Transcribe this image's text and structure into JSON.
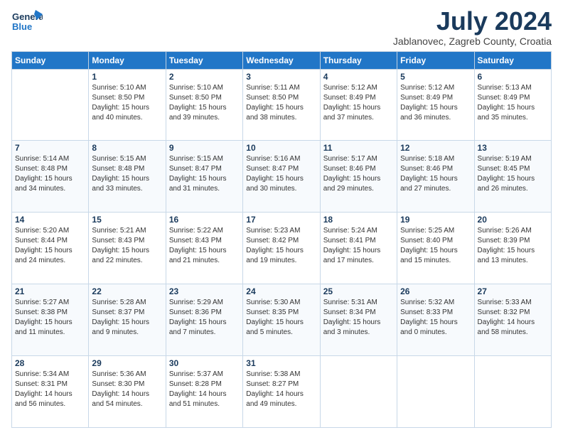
{
  "header": {
    "logo_general": "General",
    "logo_blue": "Blue",
    "main_title": "July 2024",
    "subtitle": "Jablanovec, Zagreb County, Croatia"
  },
  "days": [
    "Sunday",
    "Monday",
    "Tuesday",
    "Wednesday",
    "Thursday",
    "Friday",
    "Saturday"
  ],
  "weeks": [
    [
      {
        "day": "",
        "info": ""
      },
      {
        "day": "1",
        "info": "Sunrise: 5:10 AM\nSunset: 8:50 PM\nDaylight: 15 hours\nand 40 minutes."
      },
      {
        "day": "2",
        "info": "Sunrise: 5:10 AM\nSunset: 8:50 PM\nDaylight: 15 hours\nand 39 minutes."
      },
      {
        "day": "3",
        "info": "Sunrise: 5:11 AM\nSunset: 8:50 PM\nDaylight: 15 hours\nand 38 minutes."
      },
      {
        "day": "4",
        "info": "Sunrise: 5:12 AM\nSunset: 8:49 PM\nDaylight: 15 hours\nand 37 minutes."
      },
      {
        "day": "5",
        "info": "Sunrise: 5:12 AM\nSunset: 8:49 PM\nDaylight: 15 hours\nand 36 minutes."
      },
      {
        "day": "6",
        "info": "Sunrise: 5:13 AM\nSunset: 8:49 PM\nDaylight: 15 hours\nand 35 minutes."
      }
    ],
    [
      {
        "day": "7",
        "info": "Sunrise: 5:14 AM\nSunset: 8:48 PM\nDaylight: 15 hours\nand 34 minutes."
      },
      {
        "day": "8",
        "info": "Sunrise: 5:15 AM\nSunset: 8:48 PM\nDaylight: 15 hours\nand 33 minutes."
      },
      {
        "day": "9",
        "info": "Sunrise: 5:15 AM\nSunset: 8:47 PM\nDaylight: 15 hours\nand 31 minutes."
      },
      {
        "day": "10",
        "info": "Sunrise: 5:16 AM\nSunset: 8:47 PM\nDaylight: 15 hours\nand 30 minutes."
      },
      {
        "day": "11",
        "info": "Sunrise: 5:17 AM\nSunset: 8:46 PM\nDaylight: 15 hours\nand 29 minutes."
      },
      {
        "day": "12",
        "info": "Sunrise: 5:18 AM\nSunset: 8:46 PM\nDaylight: 15 hours\nand 27 minutes."
      },
      {
        "day": "13",
        "info": "Sunrise: 5:19 AM\nSunset: 8:45 PM\nDaylight: 15 hours\nand 26 minutes."
      }
    ],
    [
      {
        "day": "14",
        "info": "Sunrise: 5:20 AM\nSunset: 8:44 PM\nDaylight: 15 hours\nand 24 minutes."
      },
      {
        "day": "15",
        "info": "Sunrise: 5:21 AM\nSunset: 8:43 PM\nDaylight: 15 hours\nand 22 minutes."
      },
      {
        "day": "16",
        "info": "Sunrise: 5:22 AM\nSunset: 8:43 PM\nDaylight: 15 hours\nand 21 minutes."
      },
      {
        "day": "17",
        "info": "Sunrise: 5:23 AM\nSunset: 8:42 PM\nDaylight: 15 hours\nand 19 minutes."
      },
      {
        "day": "18",
        "info": "Sunrise: 5:24 AM\nSunset: 8:41 PM\nDaylight: 15 hours\nand 17 minutes."
      },
      {
        "day": "19",
        "info": "Sunrise: 5:25 AM\nSunset: 8:40 PM\nDaylight: 15 hours\nand 15 minutes."
      },
      {
        "day": "20",
        "info": "Sunrise: 5:26 AM\nSunset: 8:39 PM\nDaylight: 15 hours\nand 13 minutes."
      }
    ],
    [
      {
        "day": "21",
        "info": "Sunrise: 5:27 AM\nSunset: 8:38 PM\nDaylight: 15 hours\nand 11 minutes."
      },
      {
        "day": "22",
        "info": "Sunrise: 5:28 AM\nSunset: 8:37 PM\nDaylight: 15 hours\nand 9 minutes."
      },
      {
        "day": "23",
        "info": "Sunrise: 5:29 AM\nSunset: 8:36 PM\nDaylight: 15 hours\nand 7 minutes."
      },
      {
        "day": "24",
        "info": "Sunrise: 5:30 AM\nSunset: 8:35 PM\nDaylight: 15 hours\nand 5 minutes."
      },
      {
        "day": "25",
        "info": "Sunrise: 5:31 AM\nSunset: 8:34 PM\nDaylight: 15 hours\nand 3 minutes."
      },
      {
        "day": "26",
        "info": "Sunrise: 5:32 AM\nSunset: 8:33 PM\nDaylight: 15 hours\nand 0 minutes."
      },
      {
        "day": "27",
        "info": "Sunrise: 5:33 AM\nSunset: 8:32 PM\nDaylight: 14 hours\nand 58 minutes."
      }
    ],
    [
      {
        "day": "28",
        "info": "Sunrise: 5:34 AM\nSunset: 8:31 PM\nDaylight: 14 hours\nand 56 minutes."
      },
      {
        "day": "29",
        "info": "Sunrise: 5:36 AM\nSunset: 8:30 PM\nDaylight: 14 hours\nand 54 minutes."
      },
      {
        "day": "30",
        "info": "Sunrise: 5:37 AM\nSunset: 8:28 PM\nDaylight: 14 hours\nand 51 minutes."
      },
      {
        "day": "31",
        "info": "Sunrise: 5:38 AM\nSunset: 8:27 PM\nDaylight: 14 hours\nand 49 minutes."
      },
      {
        "day": "",
        "info": ""
      },
      {
        "day": "",
        "info": ""
      },
      {
        "day": "",
        "info": ""
      }
    ]
  ]
}
